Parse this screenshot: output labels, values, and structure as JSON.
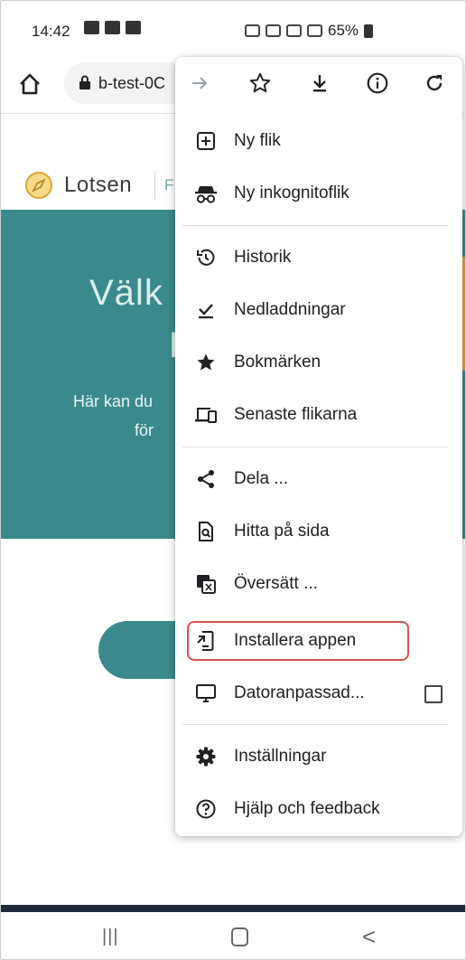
{
  "status_bar": {
    "time": "14:42",
    "battery": "65%"
  },
  "address_bar": {
    "url": "b-test-0C"
  },
  "page": {
    "logo": "Lotsen",
    "nav_initial": "F",
    "hero_line1": "Välk",
    "hero_line2": "L",
    "hero_sub1": "Här kan du",
    "hero_sub2": "för"
  },
  "menu": {
    "toolbar": [
      {
        "name": "forward-icon",
        "glyph": "→"
      },
      {
        "name": "bookmark-star-icon",
        "glyph": "☆"
      },
      {
        "name": "download-icon",
        "glyph": "⤓"
      },
      {
        "name": "info-icon",
        "glyph": "ⓘ"
      },
      {
        "name": "reload-icon",
        "glyph": "↻"
      }
    ],
    "items": [
      {
        "label": "Ny flik",
        "icon": "new-tab-icon"
      },
      {
        "label": "Ny inkognitoflik",
        "icon": "incognito-icon"
      },
      {
        "label": "Historik",
        "icon": "history-icon"
      },
      {
        "label": "Nedladdningar",
        "icon": "downloads-icon"
      },
      {
        "label": "Bokmärken",
        "icon": "star-icon"
      },
      {
        "label": "Senaste flikarna",
        "icon": "devices-icon"
      },
      {
        "label": "Dela ...",
        "icon": "share-icon"
      },
      {
        "label": "Hitta på sida",
        "icon": "find-in-page-icon"
      },
      {
        "label": "Översätt ...",
        "icon": "translate-icon"
      },
      {
        "label": "Installera appen",
        "icon": "install-app-icon"
      },
      {
        "label": "Datoranpassad...",
        "icon": "desktop-icon"
      },
      {
        "label": "Inställningar",
        "icon": "settings-icon"
      },
      {
        "label": "Hjälp och feedback",
        "icon": "help-icon"
      }
    ]
  },
  "system_nav": {
    "recent": "|||",
    "back": "<"
  }
}
